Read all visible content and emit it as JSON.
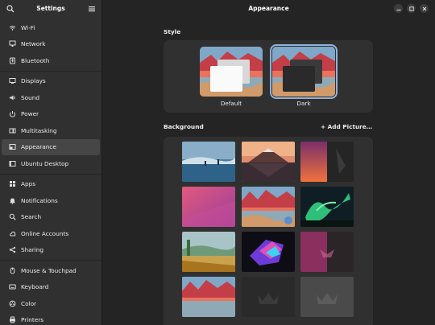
{
  "sidebar": {
    "title": "Settings",
    "groups": [
      [
        {
          "label": "Wi-Fi",
          "icon": "wifi-icon"
        },
        {
          "label": "Network",
          "icon": "network-icon"
        },
        {
          "label": "Bluetooth",
          "icon": "bluetooth-icon"
        }
      ],
      [
        {
          "label": "Displays",
          "icon": "display-icon"
        },
        {
          "label": "Sound",
          "icon": "sound-icon"
        },
        {
          "label": "Power",
          "icon": "power-icon"
        },
        {
          "label": "Multitasking",
          "icon": "multitasking-icon"
        },
        {
          "label": "Appearance",
          "icon": "appearance-icon",
          "active": true
        },
        {
          "label": "Ubuntu Desktop",
          "icon": "ubuntu-desktop-icon"
        }
      ],
      [
        {
          "label": "Apps",
          "icon": "apps-icon"
        },
        {
          "label": "Notifications",
          "icon": "bell-icon"
        },
        {
          "label": "Search",
          "icon": "search-icon"
        },
        {
          "label": "Online Accounts",
          "icon": "online-accounts-icon"
        },
        {
          "label": "Sharing",
          "icon": "sharing-icon"
        }
      ],
      [
        {
          "label": "Mouse & Touchpad",
          "icon": "mouse-icon"
        },
        {
          "label": "Keyboard",
          "icon": "keyboard-icon"
        },
        {
          "label": "Color",
          "icon": "color-icon"
        },
        {
          "label": "Printers",
          "icon": "printer-icon"
        }
      ]
    ]
  },
  "main": {
    "title": "Appearance",
    "style_label": "Style",
    "themes": [
      {
        "label": "Default",
        "selected": false
      },
      {
        "label": "Dark",
        "selected": true
      }
    ],
    "background_label": "Background",
    "add_picture_label": "+ Add Picture…",
    "wallpapers": [
      "lake-reflection",
      "mountain-sunset",
      "orange-dark-split",
      "pink-gradient",
      "desert-canyon",
      "aurora",
      "painted-landscape",
      "neon-prism",
      "magenta-dark-split",
      "desert-canyon-2",
      "dark-crown",
      "gray-crown"
    ],
    "selected_wallpaper": "desert-canyon"
  },
  "colors": {
    "accent": "#5a8ed0",
    "sidebar_bg": "#303030",
    "main_bg": "#242424",
    "card_bg": "#303030"
  }
}
